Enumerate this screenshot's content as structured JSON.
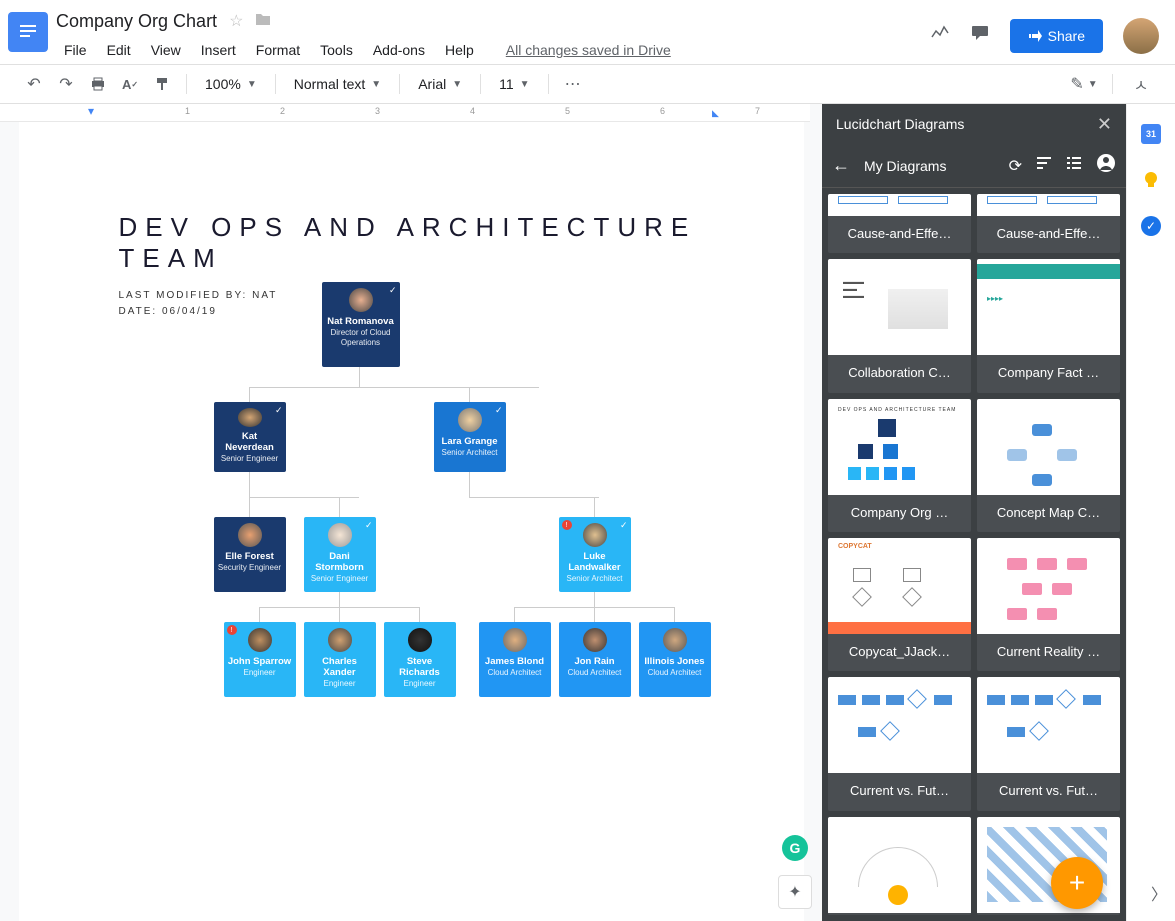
{
  "doc": {
    "title": "Company Org Chart",
    "save_status": "All changes saved in Drive"
  },
  "menus": [
    "File",
    "Edit",
    "View",
    "Insert",
    "Format",
    "Tools",
    "Add-ons",
    "Help"
  ],
  "toolbar": {
    "zoom": "100%",
    "style": "Normal text",
    "font": "Arial",
    "size": "11"
  },
  "share_label": "Share",
  "document": {
    "heading": "DEV OPS AND ARCHITECTURE TEAM",
    "meta_by": "LAST MODIFIED BY: NAT",
    "meta_date": "DATE: 06/04/19"
  },
  "chart_data": {
    "type": "org-chart",
    "root": {
      "name": "Nat Romanova",
      "role": "Director of Cloud Operations",
      "color": "navy",
      "badge": "check"
    },
    "level2": [
      {
        "name": "Kat Neverdean",
        "role": "Senior Engineer",
        "color": "navy",
        "badge": "check"
      },
      {
        "name": "Lara Grange",
        "role": "Senior Architect",
        "color": "blue",
        "badge": "check"
      }
    ],
    "level3": [
      {
        "name": "Elle Forest",
        "role": "Security Engineer",
        "color": "navy",
        "parent": 0
      },
      {
        "name": "Dani Stormborn",
        "role": "Senior Engineer",
        "color": "light",
        "parent": 0,
        "badge": "check"
      },
      {
        "name": "Luke Landwalker",
        "role": "Senior Architect",
        "color": "light",
        "parent": 1,
        "badge": "check",
        "warn": true
      }
    ],
    "level4": [
      {
        "name": "John Sparrow",
        "role": "Engineer",
        "color": "light",
        "parent": 1,
        "warn": true
      },
      {
        "name": "Charles Xander",
        "role": "Engineer",
        "color": "light",
        "parent": 1
      },
      {
        "name": "Steve Richards",
        "role": "Engineer",
        "color": "light",
        "parent": 1
      },
      {
        "name": "James Blond",
        "role": "Cloud Architect",
        "color": "mid",
        "parent": 2
      },
      {
        "name": "Jon Rain",
        "role": "Cloud Architect",
        "color": "mid",
        "parent": 2
      },
      {
        "name": "Illinois Jones",
        "role": "Cloud Architect",
        "color": "mid",
        "parent": 2
      }
    ]
  },
  "panel": {
    "header": "Lucidchart Diagrams",
    "title": "My Diagrams",
    "diagrams": [
      "Cause-and-Effe…",
      "Cause-and-Effe…",
      "Collaboration C…",
      "Company Fact …",
      "Company Org …",
      "Concept Map C…",
      "Copycat_JJack…",
      "Current Reality …",
      "Current vs. Fut…",
      "Current vs. Fut…",
      "",
      ""
    ]
  },
  "ruler_marks": [
    "1",
    "2",
    "3",
    "4",
    "5",
    "6",
    "7"
  ],
  "calendar_day": "31"
}
